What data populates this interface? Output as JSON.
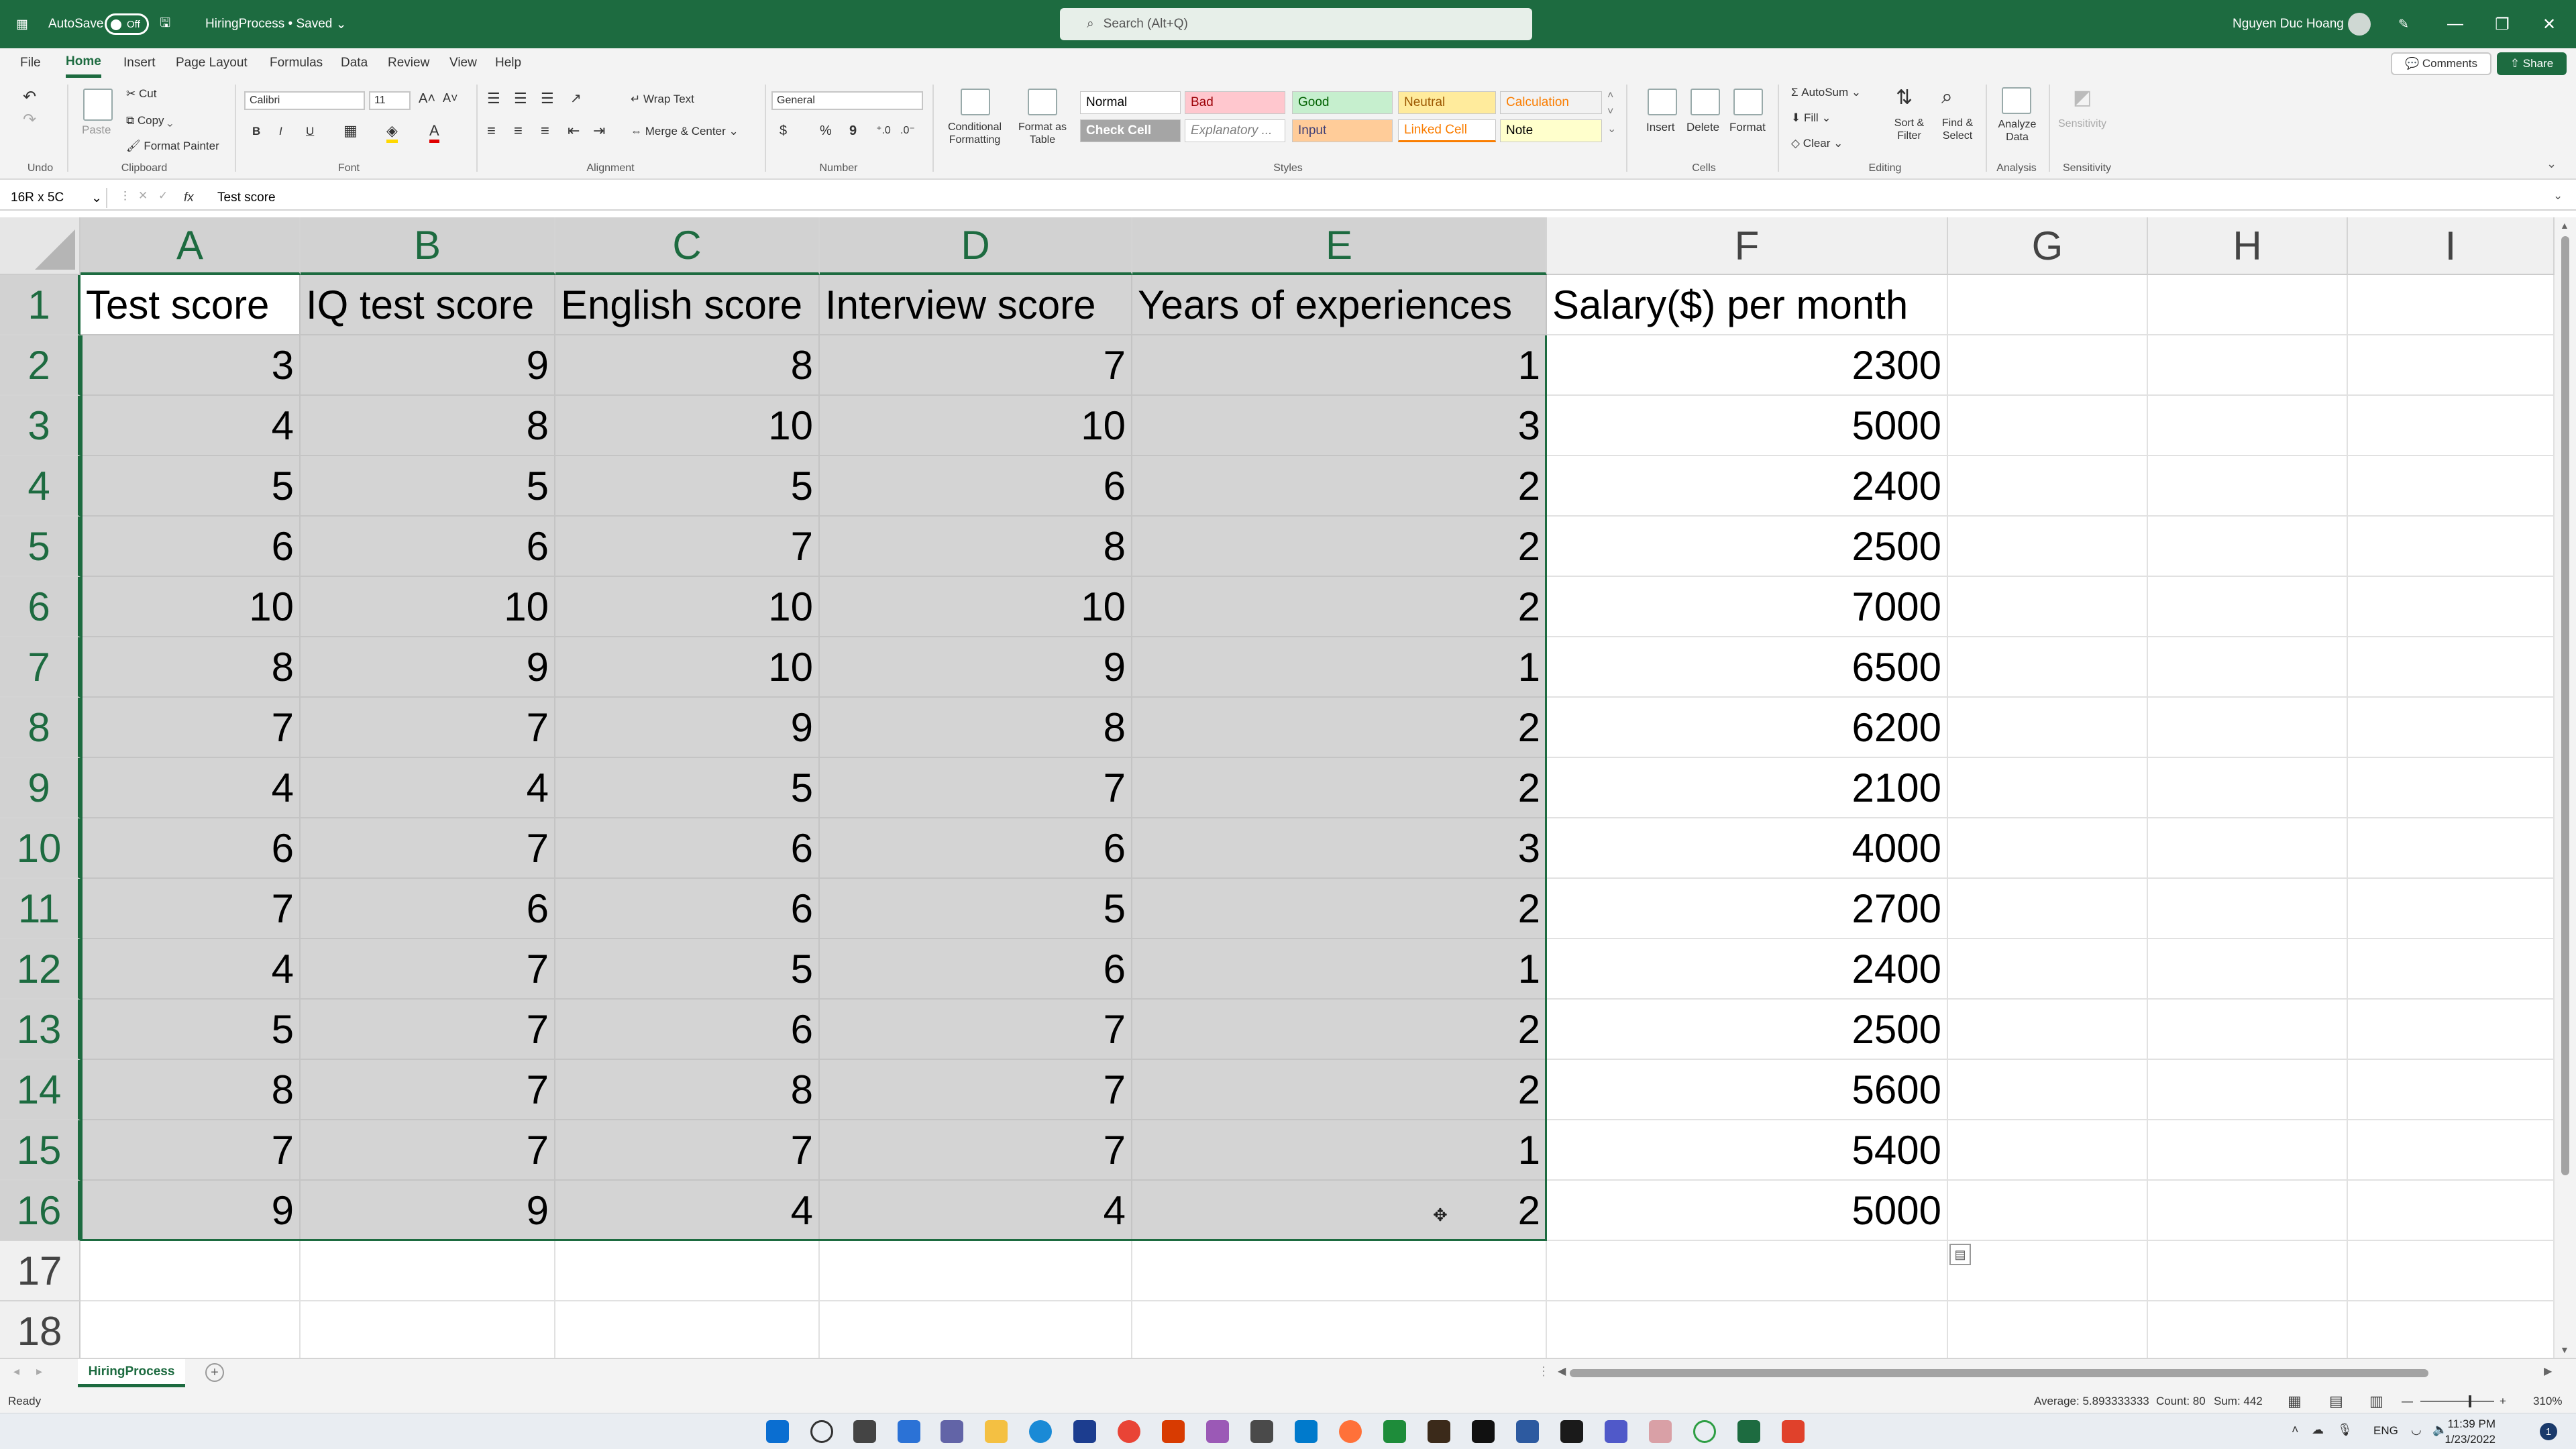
{
  "titlebar": {
    "autosave_label": "AutoSave",
    "autosave_state": "Off",
    "document_title": "HiringProcess • Saved",
    "search_placeholder": "Search (Alt+Q)",
    "user_name": "Nguyen Duc Hoang",
    "accent": "#1d6b40"
  },
  "menu": {
    "tabs": [
      "File",
      "Home",
      "Insert",
      "Page Layout",
      "Formulas",
      "Data",
      "Review",
      "View",
      "Help"
    ],
    "active": "Home",
    "comments_label": "Comments",
    "share_label": "Share"
  },
  "ribbon": {
    "undo_group": "Undo",
    "clipboard": {
      "paste": "Paste",
      "cut": "Cut",
      "copy": "Copy",
      "format_painter": "Format Painter",
      "label": "Clipboard"
    },
    "font": {
      "name": "Calibri",
      "size": "11",
      "bold": "B",
      "italic": "I",
      "underline": "U",
      "label": "Font"
    },
    "alignment": {
      "wrap_text": "Wrap Text",
      "merge_center": "Merge & Center",
      "label": "Alignment"
    },
    "number": {
      "format": "General",
      "currency": "$",
      "percent": "%",
      "comma": "9",
      "label": "Number"
    },
    "styles": {
      "conditional_formatting": "Conditional Formatting",
      "format_as_table": "Format as Table",
      "cells": [
        {
          "name": "Normal",
          "bg": "#ffffff",
          "fg": "#000000"
        },
        {
          "name": "Bad",
          "bg": "#ffc7ce",
          "fg": "#9c0006"
        },
        {
          "name": "Good",
          "bg": "#c6efce",
          "fg": "#006100"
        },
        {
          "name": "Neutral",
          "bg": "#ffeb9c",
          "fg": "#9c5700"
        },
        {
          "name": "Calculation",
          "bg": "#f2f2f2",
          "fg": "#fa7d00"
        },
        {
          "name": "Check Cell",
          "bg": "#a5a5a5",
          "fg": "#ffffff"
        },
        {
          "name": "Explanatory ...",
          "bg": "#ffffff",
          "fg": "#7f7f7f"
        },
        {
          "name": "Input",
          "bg": "#ffcc99",
          "fg": "#3f3f76"
        },
        {
          "name": "Linked Cell",
          "bg": "#ffffff",
          "fg": "#fa7d00"
        },
        {
          "name": "Note",
          "bg": "#ffffcc",
          "fg": "#000000"
        }
      ],
      "label": "Styles"
    },
    "cells_group": {
      "insert": "Insert",
      "delete": "Delete",
      "format": "Format",
      "label": "Cells"
    },
    "editing": {
      "autosum": "AutoSum",
      "fill": "Fill",
      "clear": "Clear",
      "sort_filter": "Sort & Filter",
      "find_select": "Find & Select",
      "label": "Editing"
    },
    "analysis": {
      "analyze_data": "Analyze Data",
      "label": "Analysis"
    },
    "sensitivity": {
      "button": "Sensitivity",
      "label": "Sensitivity"
    }
  },
  "formula_bar": {
    "name_box": "16R x 5C",
    "fx": "fx",
    "content": "Test score"
  },
  "sheet": {
    "columns": [
      "A",
      "B",
      "C",
      "D",
      "E",
      "F",
      "G",
      "H",
      "I"
    ],
    "rows": [
      "1",
      "2",
      "3",
      "4",
      "5",
      "6",
      "7",
      "8",
      "9",
      "10",
      "11",
      "12",
      "13",
      "14",
      "15",
      "16",
      "17",
      "18"
    ],
    "headers": [
      "Test score",
      "IQ test score",
      "English score",
      "Interview score",
      "Years of experiences",
      "Salary($) per month"
    ],
    "data": [
      [
        "3",
        "9",
        "8",
        "7",
        "1",
        "2300"
      ],
      [
        "4",
        "8",
        "10",
        "10",
        "3",
        "5000"
      ],
      [
        "5",
        "5",
        "5",
        "6",
        "2",
        "2400"
      ],
      [
        "6",
        "6",
        "7",
        "8",
        "2",
        "2500"
      ],
      [
        "10",
        "10",
        "10",
        "10",
        "2",
        "7000"
      ],
      [
        "8",
        "9",
        "10",
        "9",
        "1",
        "6500"
      ],
      [
        "7",
        "7",
        "9",
        "8",
        "2",
        "6200"
      ],
      [
        "4",
        "4",
        "5",
        "7",
        "2",
        "2100"
      ],
      [
        "6",
        "7",
        "6",
        "6",
        "3",
        "4000"
      ],
      [
        "7",
        "6",
        "6",
        "5",
        "2",
        "2700"
      ],
      [
        "4",
        "7",
        "5",
        "6",
        "1",
        "2400"
      ],
      [
        "5",
        "7",
        "6",
        "7",
        "2",
        "2500"
      ],
      [
        "8",
        "7",
        "8",
        "7",
        "2",
        "5600"
      ],
      [
        "7",
        "7",
        "7",
        "7",
        "1",
        "5400"
      ],
      [
        "9",
        "9",
        "4",
        "4",
        "2",
        "5000"
      ]
    ]
  },
  "sheet_tabs": {
    "active": "HiringProcess"
  },
  "status": {
    "ready": "Ready",
    "average": "Average: 5.893333333",
    "count": "Count: 80",
    "sum": "Sum: 442",
    "zoom": "310%"
  },
  "taskbar": {
    "lang": "ENG",
    "time": "11:39 PM",
    "date": "1/23/2022"
  }
}
